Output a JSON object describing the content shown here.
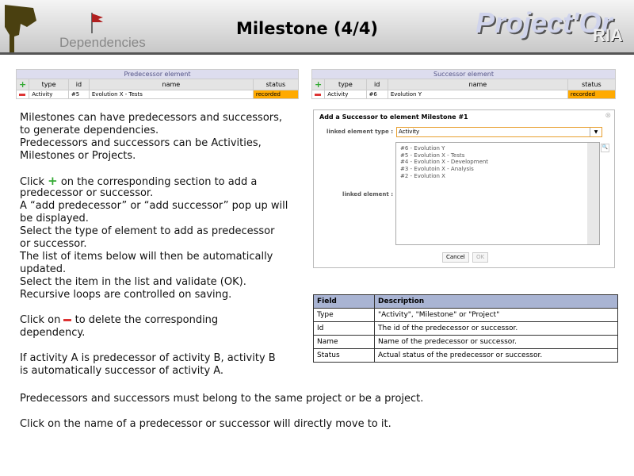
{
  "header": {
    "section": "Dependencies",
    "title": "Milestone (4/4)",
    "brand": "Project'Or",
    "brand_sub": "RIA"
  },
  "predecessor": {
    "caption": "Predecessor element",
    "cols": [
      "type",
      "id",
      "name",
      "status"
    ],
    "row": {
      "type": "Activity",
      "id": "#5",
      "name": "Evolution X - Tests",
      "status": "recorded"
    }
  },
  "successor": {
    "caption": "Successor element",
    "cols": [
      "type",
      "id",
      "name",
      "status"
    ],
    "row": {
      "type": "Activity",
      "id": "#6",
      "name": "Evolution Y",
      "status": "recorded"
    }
  },
  "text": [
    "Milestones can have predecessors and successors,",
    "to generate dependencies.",
    "Predecessors and successors can be Activities,",
    "Milestones or Projects.",
    "Click",
    "on the corresponding section to add a",
    "predecessor or successor.",
    "A “add predecessor” or “add successor” pop up will",
    "be displayed.",
    "Select the type of element to add as predecessor",
    "or successor.",
    "The list of items below will then be automatically",
    "updated.",
    "Select the item in the list and validate (OK).",
    "Recursive loops are controlled on saving.",
    "Click on",
    "to delete the corresponding",
    "dependency.",
    "If activity A is predecessor of activity B, activity B",
    "is automatically successor of activity A.",
    "Predecessors and successors must belong to the same project or be a project.",
    "Click on the name of a predecessor or successor will directly move to it."
  ],
  "dialog": {
    "title": "Add a Successor to element Milestone #1",
    "type_label": "linked element type :",
    "type_value": "Activity",
    "element_label": "linked element :",
    "items": [
      "#6 - Evolution Y",
      "#5 - Evolution X - Tests",
      "#4 - Evolution X - Development",
      "#3 - Evolutoin X - Analysis",
      "#2 - Evolution X"
    ],
    "cancel": "Cancel",
    "ok": "OK"
  },
  "fields": {
    "headers": [
      "Field",
      "Description"
    ],
    "rows": [
      [
        "Type",
        "\"Activity\", \"Milestone\" or \"Project\""
      ],
      [
        "Id",
        "The id of the predecessor or successor."
      ],
      [
        "Name",
        "Name of the predecessor or successor."
      ],
      [
        "Status",
        "Actual status of the predecessor or successor."
      ]
    ]
  }
}
